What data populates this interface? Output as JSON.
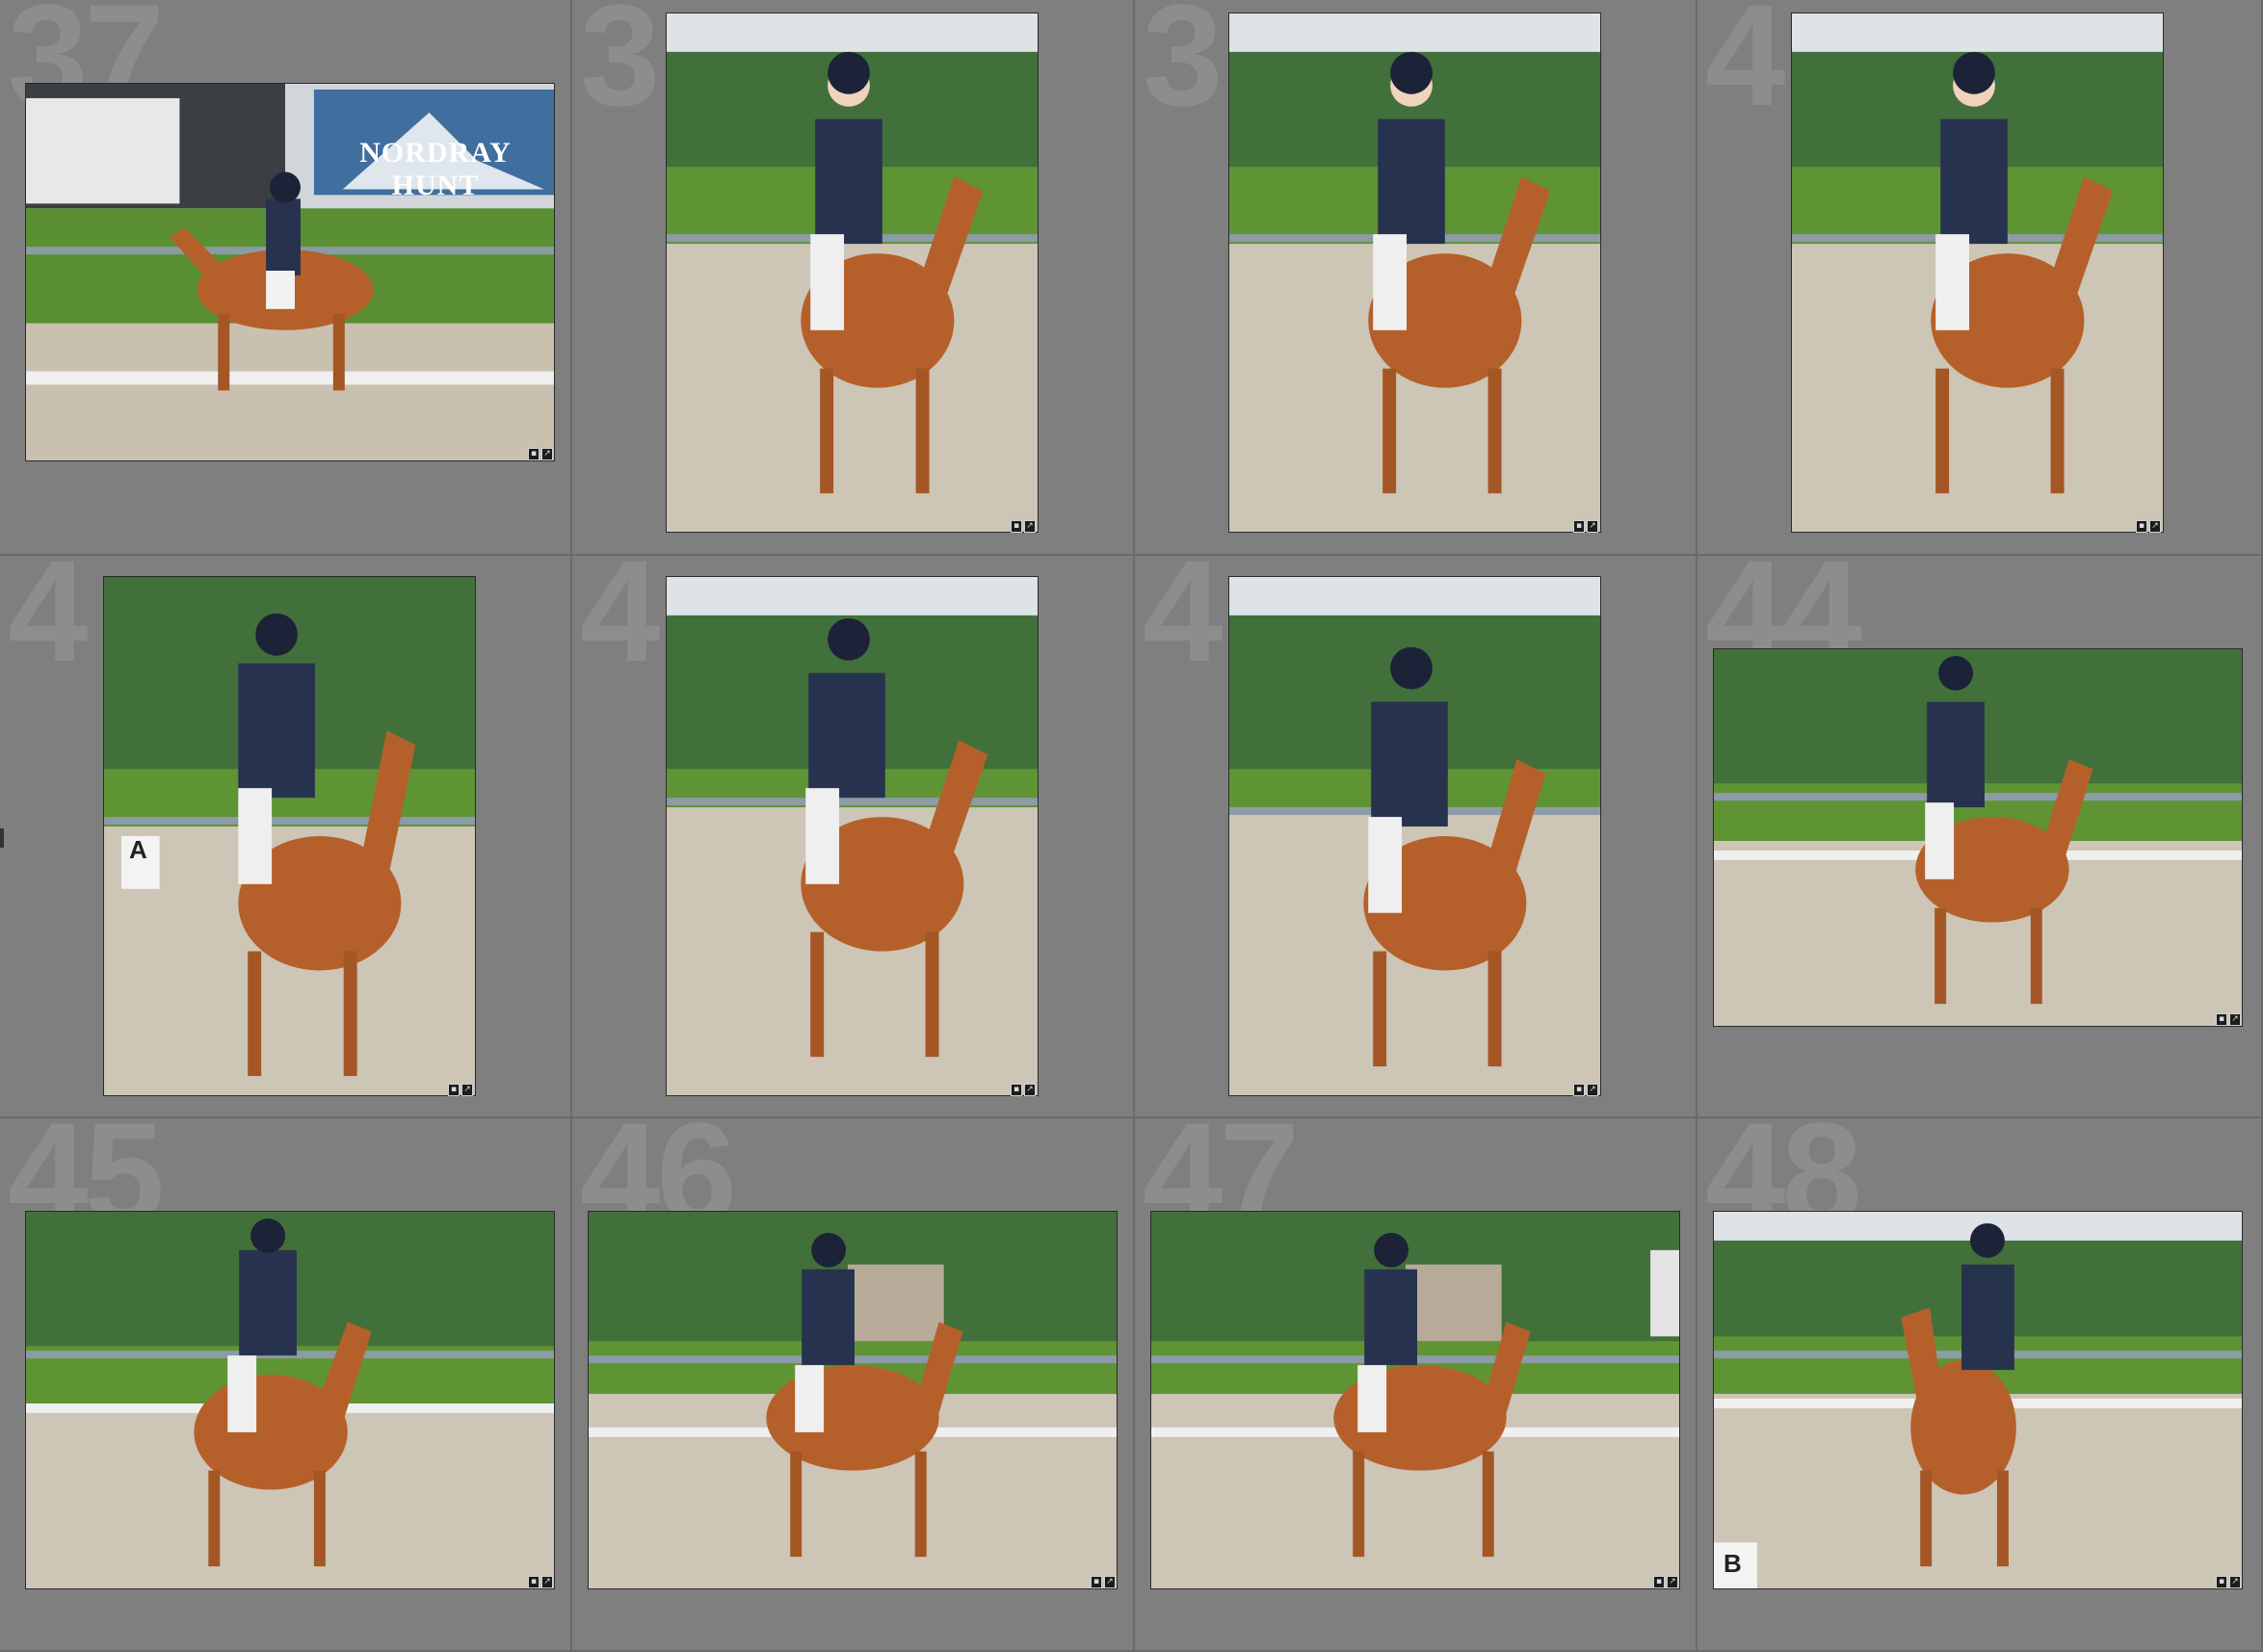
{
  "app": {
    "view": "Library Grid"
  },
  "colors": {
    "grid_background": "#7f7f7f",
    "cell_index_color": "#8d8d8d",
    "horse_chestnut": "#b5602a",
    "rider_jacket": "#27324f",
    "arena_sand": "#cfc7b8",
    "foliage": "#3f6b32",
    "grass": "#5c8f2f"
  },
  "badge_icons": [
    "metadata-icon",
    "edited-icon"
  ],
  "thumbnails": [
    {
      "index": "37",
      "orientation": "landscape",
      "banner_text": "NORDRAY HUNT"
    },
    {
      "index": "3",
      "orientation": "portrait"
    },
    {
      "index": "3",
      "orientation": "portrait"
    },
    {
      "index": "4",
      "orientation": "portrait"
    },
    {
      "index": "4",
      "orientation": "portrait",
      "marker_text": "A"
    },
    {
      "index": "4",
      "orientation": "portrait"
    },
    {
      "index": "4",
      "orientation": "portrait"
    },
    {
      "index": "44",
      "orientation": "landscape"
    },
    {
      "index": "45",
      "orientation": "landscape"
    },
    {
      "index": "46",
      "orientation": "landscape"
    },
    {
      "index": "47",
      "orientation": "landscape"
    },
    {
      "index": "48",
      "orientation": "landscape",
      "marker_text": "B"
    }
  ]
}
